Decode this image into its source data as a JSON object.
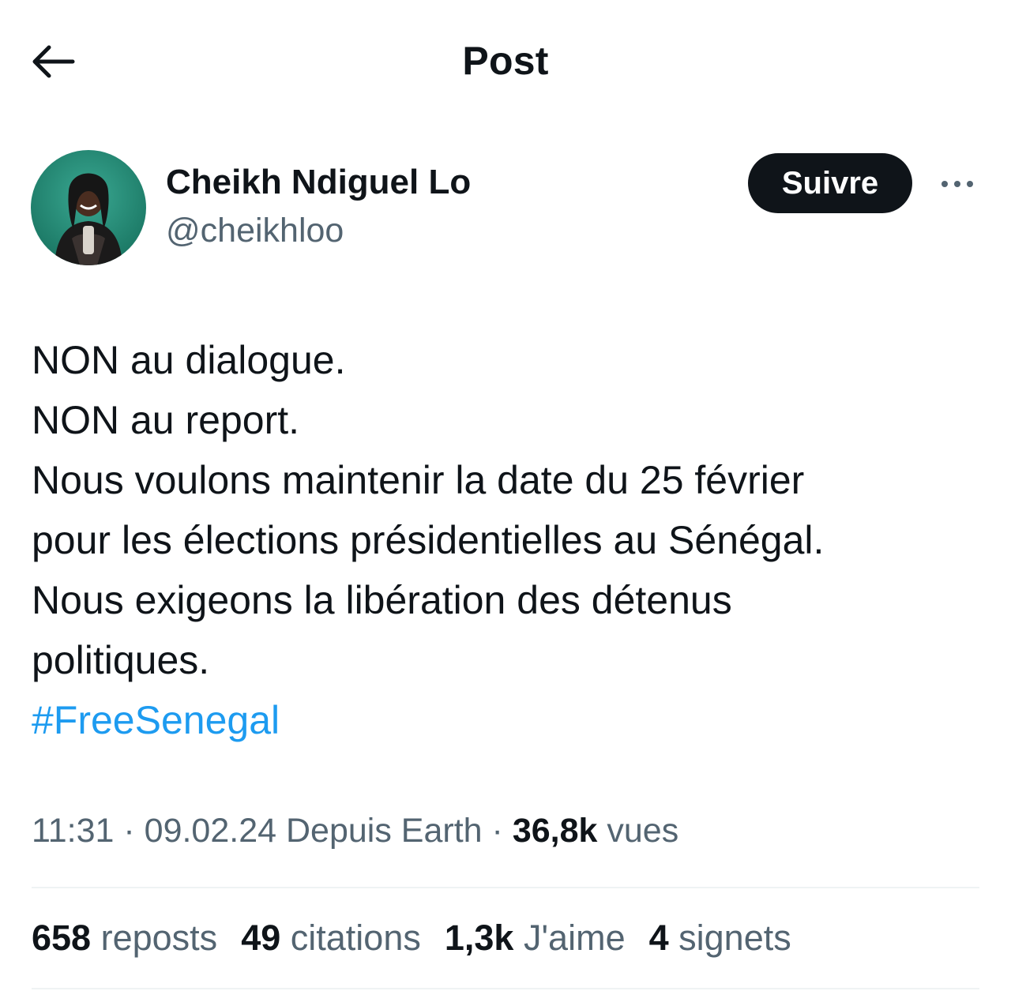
{
  "header": {
    "title": "Post",
    "back_icon": "arrow-left-icon"
  },
  "author": {
    "display_name": "Cheikh Ndiguel Lo",
    "handle": "@cheikhloo",
    "follow_label": "Suivre",
    "more_icon": "more-horizontal-icon"
  },
  "tweet": {
    "lines": [
      "NON au dialogue.",
      "NON au report.",
      "Nous voulons maintenir la date du 25 février",
      "pour les élections présidentielles au Sénégal.",
      "Nous exigeons la libération des détenus",
      "politiques."
    ],
    "hashtag": "#FreeSenegal"
  },
  "meta": {
    "time": "11:31",
    "separator": "·",
    "date": "09.02.24",
    "source": "Depuis Earth",
    "views_count": "36,8k",
    "views_label": "vues"
  },
  "stats": {
    "reposts_count": "658",
    "reposts_label": "reposts",
    "quotes_count": "49",
    "quotes_label": "citations",
    "likes_count": "1,3k",
    "likes_label": "J'aime",
    "bookmarks_count": "4",
    "bookmarks_label": "signets"
  },
  "colors": {
    "text": "#0f1419",
    "secondary": "#536471",
    "link": "#1d9bf0",
    "divider": "#eff3f4",
    "button_bg": "#0f1419"
  }
}
